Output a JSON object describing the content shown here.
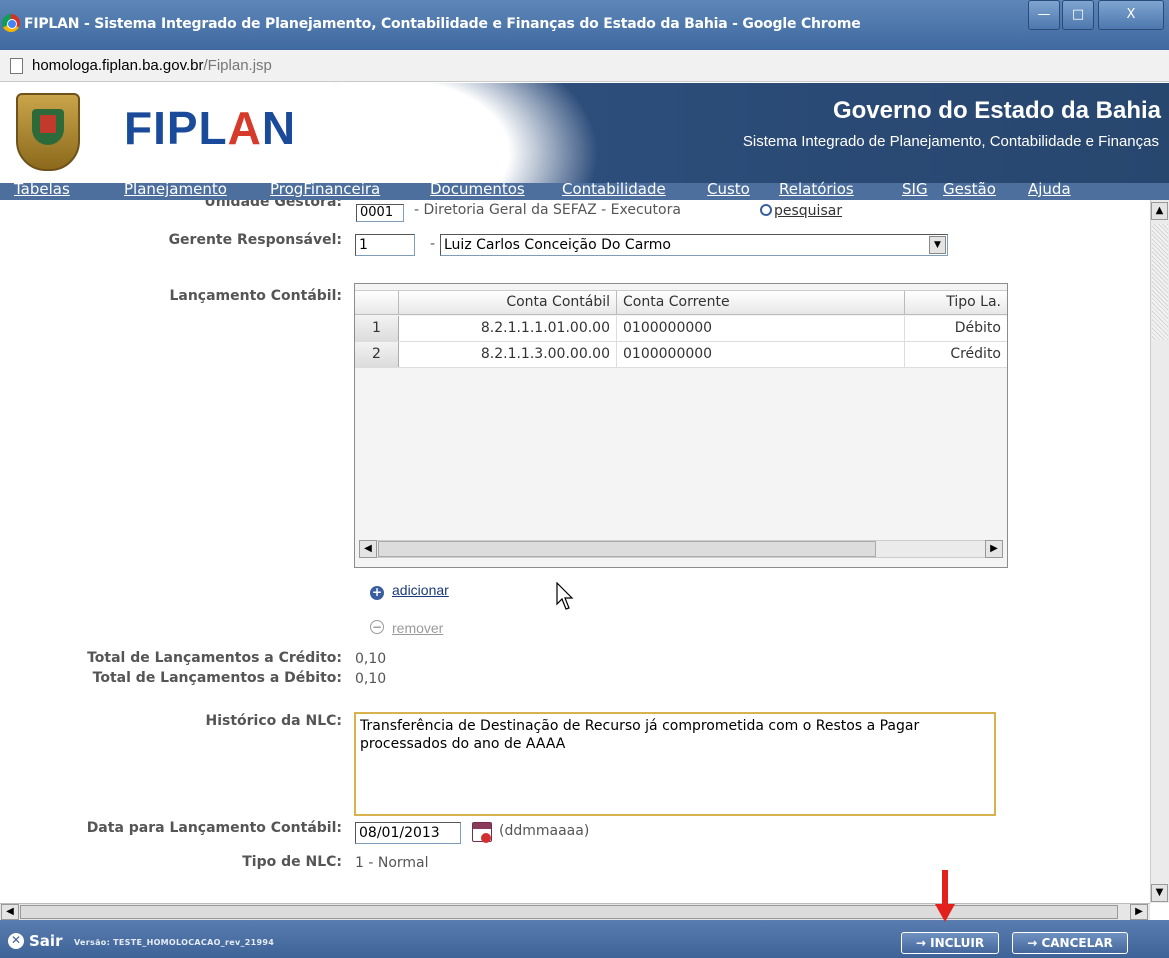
{
  "window": {
    "title": "FIPLAN - Sistema Integrado de Planejamento, Contabilidade e Finanças do Estado da Bahia - Google Chrome",
    "min_glyph": "—",
    "max_glyph": "□",
    "close_glyph": "X"
  },
  "address": {
    "host": "homologa.fiplan.ba.gov.br",
    "path": "/Fiplan.jsp"
  },
  "banner": {
    "logo_pre": "FIPL",
    "logo_a": "A",
    "logo_post": "N",
    "government": "Governo do Estado da Bahia",
    "system": "Sistema Integrado de Planejamento, Contabilidade e Finanças"
  },
  "menu": {
    "items": [
      "Tabelas",
      "Planejamento",
      "ProgFinanceira",
      "Documentos",
      "Contabilidade",
      "Custo",
      "Relatórios",
      "SIG",
      "Gestão",
      "Ajuda"
    ]
  },
  "form": {
    "unidade_gestora": {
      "label": "Unidade Gestora:",
      "code": "0001",
      "name": "- Diretoria Geral da SEFAZ - Executora",
      "search_label": "pesquisar"
    },
    "gerente": {
      "label": "Gerente Responsável:",
      "code": "1",
      "separator": "-",
      "selected": "Luiz Carlos Conceição Do Carmo"
    },
    "lancamento": {
      "label": "Lançamento Contábil:",
      "columns": [
        "Conta Contábil",
        "Conta Corrente",
        "Tipo La."
      ],
      "rows": [
        {
          "num": "1",
          "conta_contabil": "8.2.1.1.1.01.00.00",
          "conta_corrente": "0100000000",
          "tipo": "Débito"
        },
        {
          "num": "2",
          "conta_contabil": "8.2.1.1.3.00.00.00",
          "conta_corrente": "0100000000",
          "tipo": "Crédito"
        }
      ],
      "add_label": "adicionar",
      "remove_label": "remover"
    },
    "total_credito": {
      "label": "Total de Lançamentos a Crédito:",
      "value": "0,10"
    },
    "total_debito": {
      "label": "Total de Lançamentos a Débito:",
      "value": "0,10"
    },
    "historico": {
      "label": "Histórico da NLC:",
      "value": "Transferência de Destinação de Recurso já comprometida com o Restos a Pagar processados do ano de AAAA"
    },
    "data_lancamento": {
      "label": "Data para Lançamento Contábil:",
      "value": "08/01/2013",
      "hint": "(ddmmaaaa)"
    },
    "tipo_nlc": {
      "label": "Tipo de NLC:",
      "value": "1 - Normal"
    }
  },
  "statusbar": {
    "exit_label": "Sair",
    "version": "Versão: TESTE_HOMOLOCACAO_rev_21994",
    "include_button": "→ INCLUIR",
    "cancel_button": "→ CANCELAR"
  },
  "colors": {
    "header_blue": "#27476f",
    "menu_blue": "#4d6f9e",
    "logo_blue": "#1a4a9a",
    "logo_red": "#d63a2a",
    "highlight_border": "#d9b24e",
    "annotation_arrow": "#e3201b",
    "add_icon_blue": "#3a5f9e",
    "remove_icon_gray": "#9a9a9a"
  }
}
